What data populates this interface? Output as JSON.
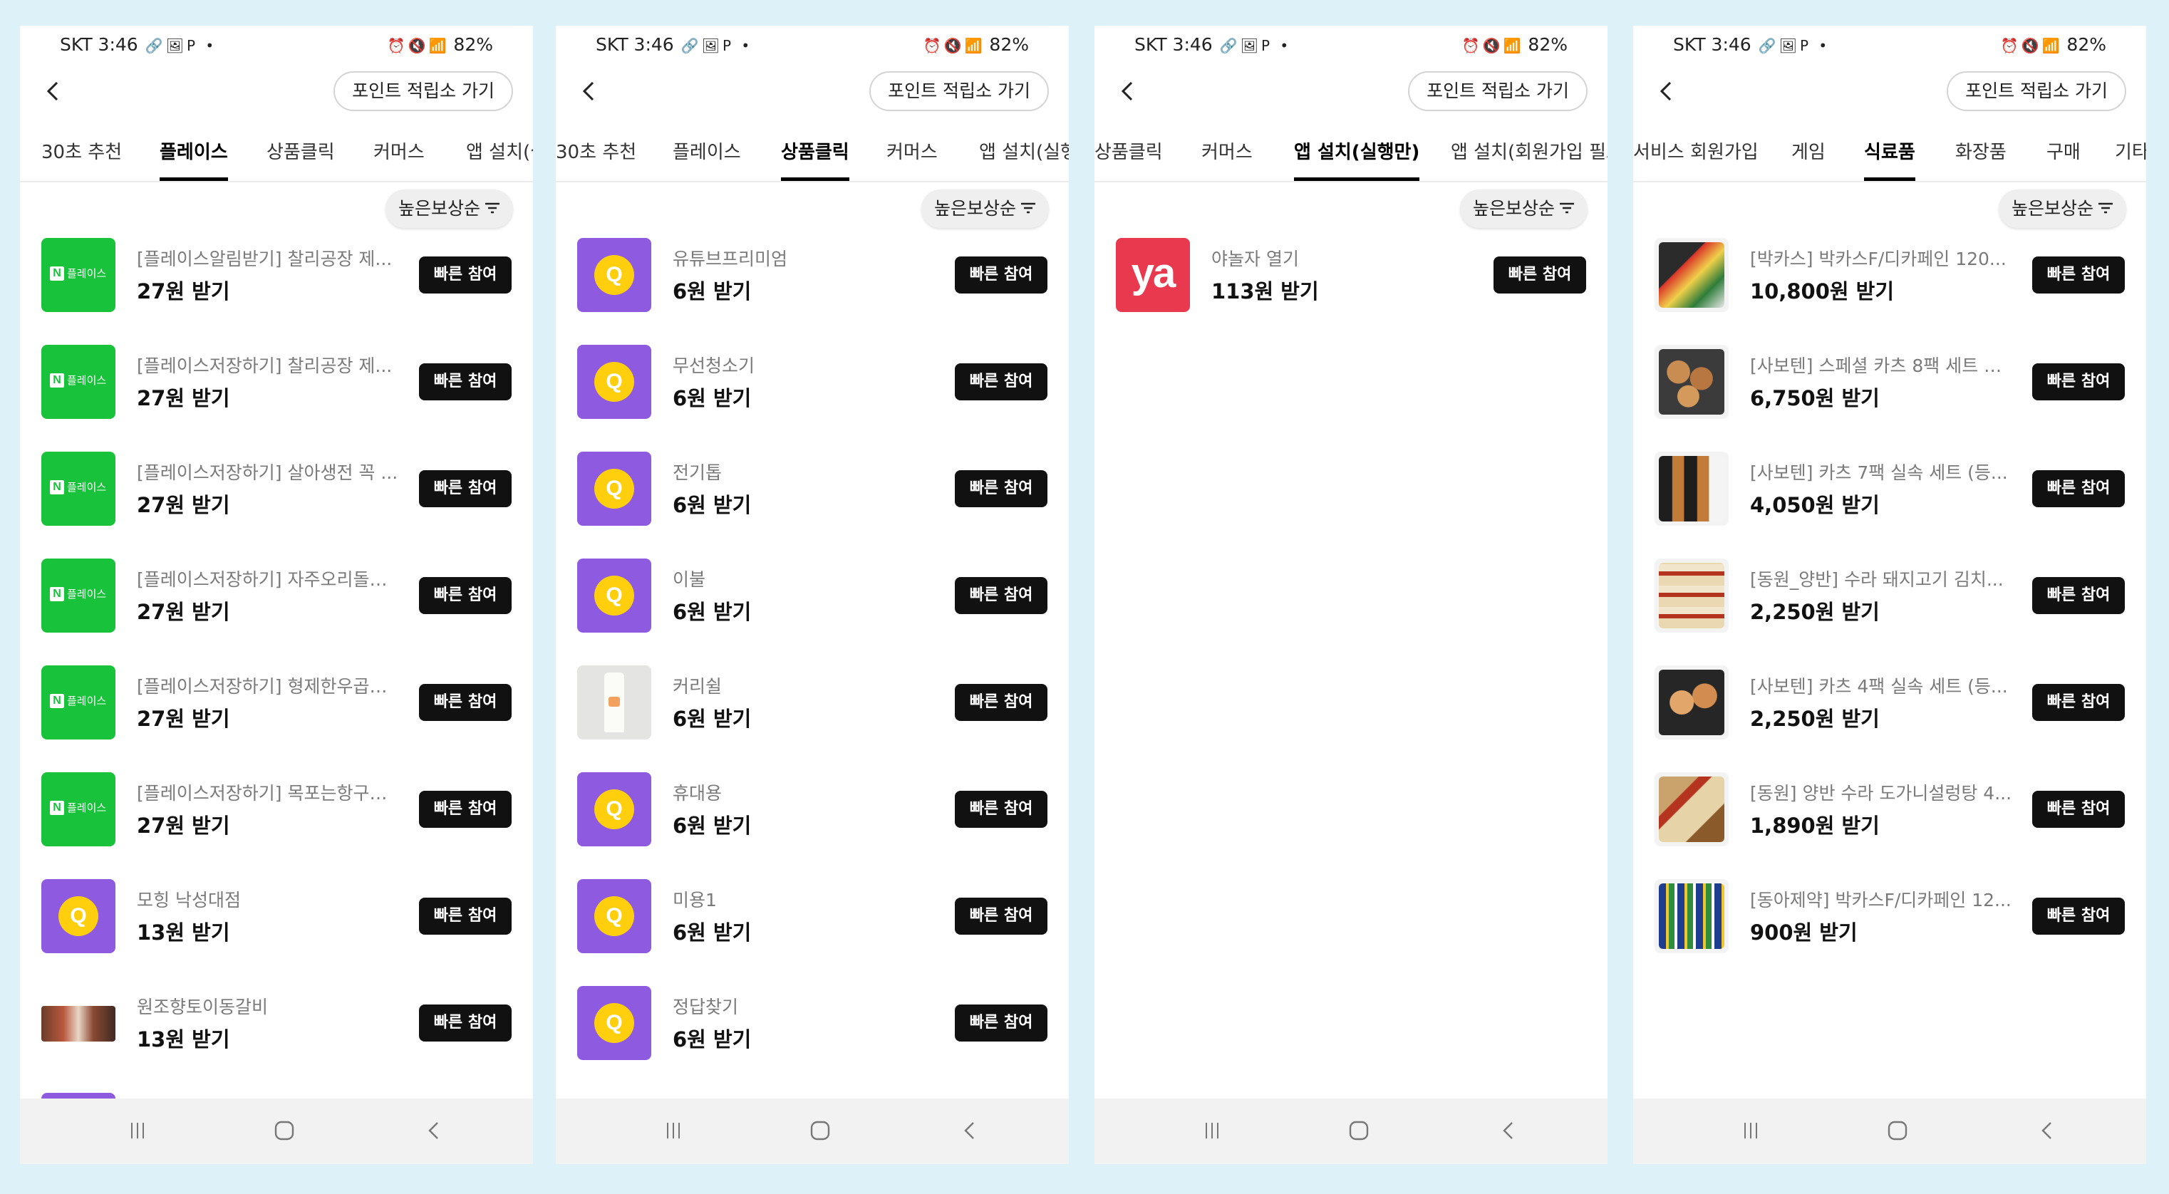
{
  "status": {
    "carrier_time": "SKT 3:46",
    "left_icons": "🔗🖼P •",
    "right_icons": "⏰🔇📶",
    "battery": "82%"
  },
  "header": {
    "point_button": "포인트 적립소 가기"
  },
  "sort_label": "높은보상순",
  "join_label": "빠른 참여",
  "panels": [
    {
      "tabs": [
        "30초 추천",
        "플레이스",
        "상품클릭",
        "커머스",
        "앱 설치(실행만)"
      ],
      "active_tab": "플레이스",
      "items": [
        {
          "thumb": "naver",
          "title": "[플레이스알림받기] 찰리공장 제...",
          "reward": "27원 받기"
        },
        {
          "thumb": "naver",
          "title": "[플레이스저장하기] 찰리공장 제...",
          "reward": "27원 받기"
        },
        {
          "thumb": "naver",
          "title": "[플레이스저장하기] 살아생전 꼭 ...",
          "reward": "27원 받기"
        },
        {
          "thumb": "naver",
          "title": "[플레이스저장하기] 자주오리돌판...",
          "reward": "27원 받기"
        },
        {
          "thumb": "naver",
          "title": "[플레이스저장하기] 형제한우곱창...",
          "reward": "27원 받기"
        },
        {
          "thumb": "naver",
          "title": "[플레이스저장하기] 목포는항구다...",
          "reward": "27원 받기"
        },
        {
          "thumb": "q",
          "title": "모힝 낙성대점",
          "reward": "13원 받기"
        },
        {
          "thumb": "photo-meat",
          "title": "원조향토이동갈비",
          "reward": "13원 받기"
        }
      ]
    },
    {
      "tabs": [
        "30초 추천",
        "플레이스",
        "상품클릭",
        "커머스",
        "앱 설치(실행만)"
      ],
      "active_tab": "상품클릭",
      "items": [
        {
          "thumb": "q",
          "title": "유튜브프리미엄",
          "reward": "6원 받기"
        },
        {
          "thumb": "q",
          "title": "무선청소기",
          "reward": "6원 받기"
        },
        {
          "thumb": "q",
          "title": "전기톱",
          "reward": "6원 받기"
        },
        {
          "thumb": "q",
          "title": "이불",
          "reward": "6원 받기"
        },
        {
          "thumb": "cream",
          "title": "커리쉴",
          "reward": "6원 받기"
        },
        {
          "thumb": "q",
          "title": "휴대용",
          "reward": "6원 받기"
        },
        {
          "thumb": "q",
          "title": "미용1",
          "reward": "6원 받기"
        },
        {
          "thumb": "q",
          "title": "정답찾기",
          "reward": "6원 받기"
        }
      ]
    },
    {
      "tabs": [
        "상품클릭",
        "커머스",
        "앱 설치(실행만)",
        "앱 설치(회원가입 필요)"
      ],
      "active_tab": "앱 설치(실행만)",
      "items": [
        {
          "thumb": "ya",
          "title": "야놀자 열기",
          "reward": "113원 받기"
        }
      ]
    },
    {
      "tabs": [
        "서비스 회원가입",
        "게임",
        "식료품",
        "화장품",
        "구매",
        "기타"
      ],
      "active_tab": "식료품",
      "items": [
        {
          "thumb": "bacchus",
          "title": "[박카스] 박카스F/디카페인 120...",
          "reward": "10,800원 받기"
        },
        {
          "thumb": "kats",
          "title": "[사보텐] 스페셜 카츠 8팩 세트 오...",
          "reward": "6,750원 받기"
        },
        {
          "thumb": "kats7",
          "title": "[사보텐] 카츠 7팩 실속 세트 (등...",
          "reward": "4,050원 받기"
        },
        {
          "thumb": "dongwon",
          "title": "[동원_양반] 수라 돼지고기 김치...",
          "reward": "2,250원 받기"
        },
        {
          "thumb": "kats4",
          "title": "[사보텐] 카츠 4팩 실속 세트 (등...",
          "reward": "2,250원 받기"
        },
        {
          "thumb": "sulung",
          "title": "[동원] 양반 수라 도가니설렁탕 4...",
          "reward": "1,890원 받기"
        },
        {
          "thumb": "bacchus12",
          "title": "[동아제약] 박카스F/디카페인 12...",
          "reward": "900원 받기"
        }
      ]
    }
  ]
}
